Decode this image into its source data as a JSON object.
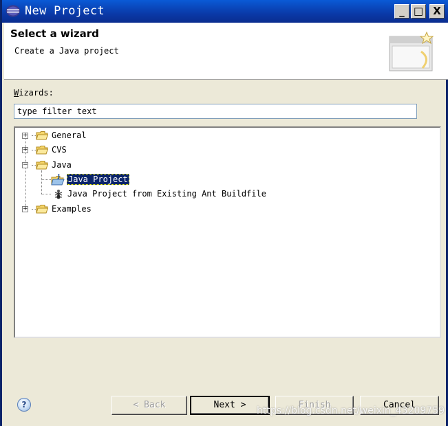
{
  "window": {
    "title": "New Project",
    "minimize_label": "_",
    "maximize_label": "□",
    "close_label": "X"
  },
  "header": {
    "title": "Select a wizard",
    "description": "Create a Java project"
  },
  "wizards": {
    "label_prefix": "W",
    "label_rest": "izards:",
    "filter_value": "type filter text"
  },
  "tree": {
    "items": [
      {
        "label": "General",
        "expander": "+"
      },
      {
        "label": "CVS",
        "expander": "+"
      },
      {
        "label": "Java",
        "expander": "−"
      },
      {
        "label": "Java Project"
      },
      {
        "label": "Java Project from Existing Ant Buildfile"
      },
      {
        "label": "Examples",
        "expander": "+"
      }
    ]
  },
  "buttons": {
    "help_symbol": "?",
    "back_label": "< Back",
    "next_label": "Next >",
    "finish_label": "Finish",
    "cancel_label": "Cancel"
  },
  "watermark": "https://blog.csdn.net/weixin_43209759",
  "colors": {
    "titlebar": "#0a3aa8",
    "selection": "#0a246a",
    "dialog_bg": "#ece9d8"
  }
}
